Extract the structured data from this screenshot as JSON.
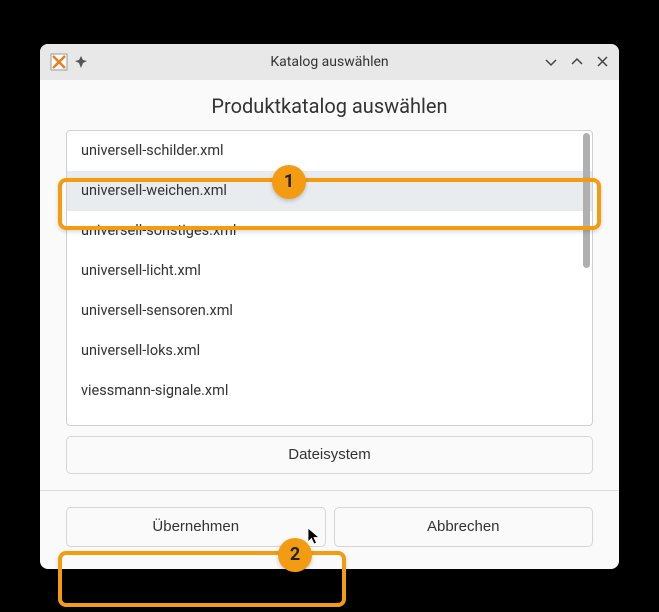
{
  "window": {
    "title": "Katalog auswählen"
  },
  "heading": "Produktkatalog auswählen",
  "list": {
    "items": [
      {
        "label": "universell-schilder.xml",
        "selected": false
      },
      {
        "label": "universell-weichen.xml",
        "selected": true
      },
      {
        "label": "universell-sonstiges.xml",
        "selected": false
      },
      {
        "label": "universell-licht.xml",
        "selected": false
      },
      {
        "label": "universell-sensoren.xml",
        "selected": false
      },
      {
        "label": "universell-loks.xml",
        "selected": false
      },
      {
        "label": "viessmann-signale.xml",
        "selected": false
      }
    ]
  },
  "buttons": {
    "filesystem": "Dateisystem",
    "apply": "Übernehmen",
    "cancel": "Abbrechen"
  },
  "callouts": {
    "one": "1",
    "two": "2"
  }
}
